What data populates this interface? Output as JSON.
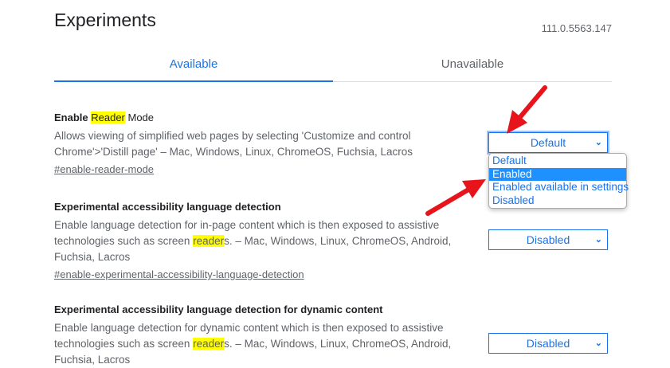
{
  "header": {
    "title": "Experiments",
    "version": "111.0.5563.147"
  },
  "tabs": [
    {
      "label": "Available",
      "active": true
    },
    {
      "label": "Unavailable",
      "active": false
    }
  ],
  "experiments": [
    {
      "title_pre": "Enable ",
      "title_hl": "Reader",
      "title_post": " Mode",
      "description": "Allows viewing of simplified web pages by selecting 'Customize and control Chrome'>'Distill page' – Mac, Windows, Linux, ChromeOS, Fuchsia, Lacros",
      "link": "#enable-reader-mode",
      "value": "Default"
    },
    {
      "title": "Experimental accessibility language detection",
      "desc_pre": "Enable language detection for in-page content which is then exposed to assistive technologies such as screen ",
      "desc_hl": "reader",
      "desc_post": "s. – Mac, Windows, Linux, ChromeOS, Android, Fuchsia, Lacros",
      "link": "#enable-experimental-accessibility-language-detection",
      "value": "Disabled"
    },
    {
      "title": "Experimental accessibility language detection for dynamic content",
      "desc_pre": "Enable language detection for dynamic content which is then exposed to assistive technologies such as screen ",
      "desc_hl": "reader",
      "desc_post": "s. – Mac, Windows, Linux, ChromeOS, Android, Fuchsia, Lacros",
      "value": "Disabled"
    }
  ],
  "dropdown": {
    "options": [
      "Default",
      "Enabled",
      "Enabled available in settings",
      "Disabled"
    ],
    "highlighted": "Enabled"
  },
  "colors": {
    "accent": "#1a73e8",
    "highlight": "#ffff00",
    "arrow": "#e8141c"
  }
}
